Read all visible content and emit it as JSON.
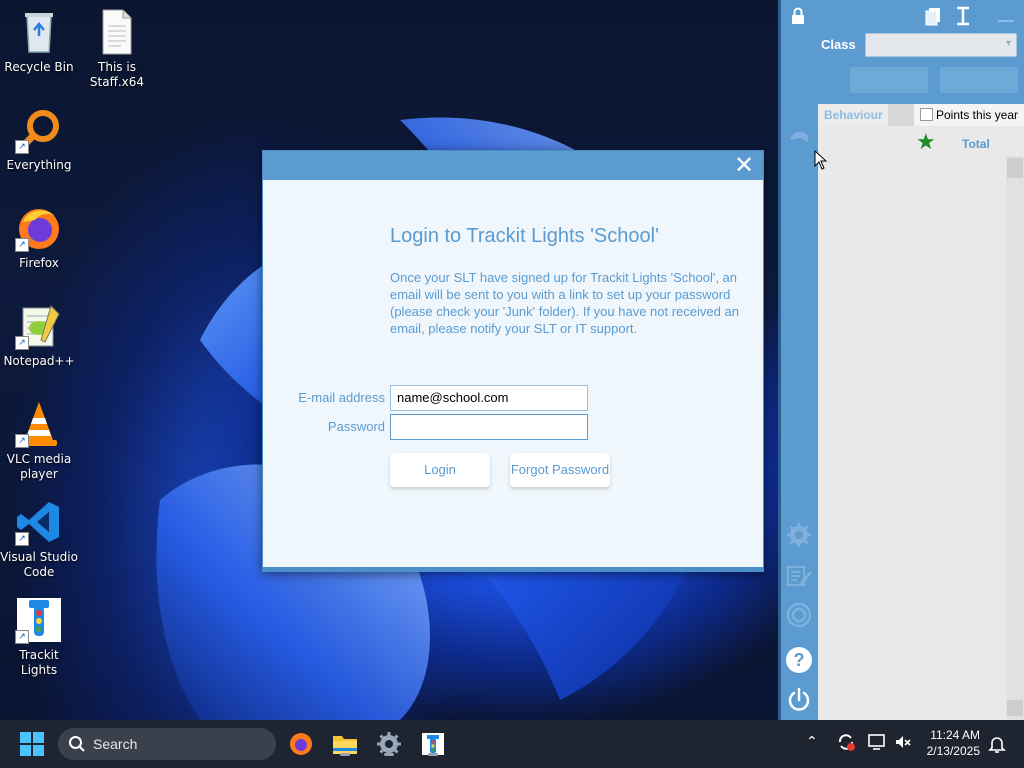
{
  "desktop": {
    "icons": [
      {
        "label": "Recycle Bin",
        "icon": "recycle-bin-icon"
      },
      {
        "label": "This is Staff.x64",
        "icon": "document-icon"
      },
      {
        "label": "Everything",
        "icon": "search-magnifier-icon"
      },
      {
        "label": "Firefox",
        "icon": "firefox-icon"
      },
      {
        "label": "Notepad++",
        "icon": "notepad-plus-plus-icon"
      },
      {
        "label": "VLC media player",
        "icon": "vlc-cone-icon"
      },
      {
        "label": "Visual Studio Code",
        "icon": "vscode-icon"
      },
      {
        "label": "Trackit Lights",
        "icon": "traffic-light-icon"
      }
    ]
  },
  "dialog": {
    "title": "Login to Trackit Lights 'School'",
    "message": "Once your SLT have signed up for Trackit Lights 'School', an email will be sent to you with a link to set up your password (please check your 'Junk' folder). If you have not received an email, please notify your SLT or IT support.",
    "email_label": "E-mail address",
    "email_value": "name@school.com",
    "password_label": "Password",
    "password_value": "",
    "login_button": "Login",
    "forgot_button": "Forgot Password",
    "close_glyph": "✕"
  },
  "panel": {
    "class_label": "Class",
    "class_value": "",
    "behaviour_tab": "Behaviour",
    "points_checkbox_label": "Points this year",
    "total_label": "Total",
    "colors": {
      "panel": "#5b9bd0",
      "accent_green": "#1f8a2a"
    }
  },
  "taskbar": {
    "search_placeholder": "Search",
    "time": "11:24 AM",
    "date": "2/13/2025"
  }
}
